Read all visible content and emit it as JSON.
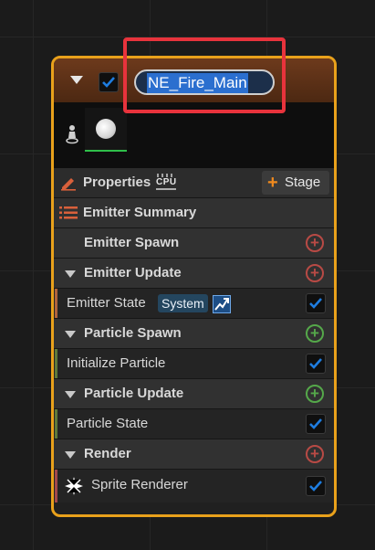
{
  "emitter": {
    "name": "NE_Fire_Main",
    "enabled": true
  },
  "toolbar": {
    "properties_label": "Properties",
    "cpu_label": "CPU",
    "stage_label": "Stage"
  },
  "summary": {
    "label": "Emitter Summary"
  },
  "groups": {
    "emitter_spawn": "Emitter Spawn",
    "emitter_update": "Emitter Update",
    "particle_spawn": "Particle Spawn",
    "particle_update": "Particle Update",
    "render": "Render"
  },
  "modules": {
    "emitter_state": {
      "label": "Emitter State",
      "badge": "System",
      "checked": true
    },
    "initialize_particle": {
      "label": "Initialize Particle",
      "checked": true
    },
    "particle_state": {
      "label": "Particle State",
      "checked": true
    },
    "sprite_renderer": {
      "label": "Sprite Renderer",
      "checked": true
    }
  },
  "colors": {
    "node_border": "#e9a11b",
    "highlight": "#e8333c",
    "add_red": "#b84a45",
    "add_green": "#55a84a",
    "checkbox_blue": "#1e7de0"
  }
}
